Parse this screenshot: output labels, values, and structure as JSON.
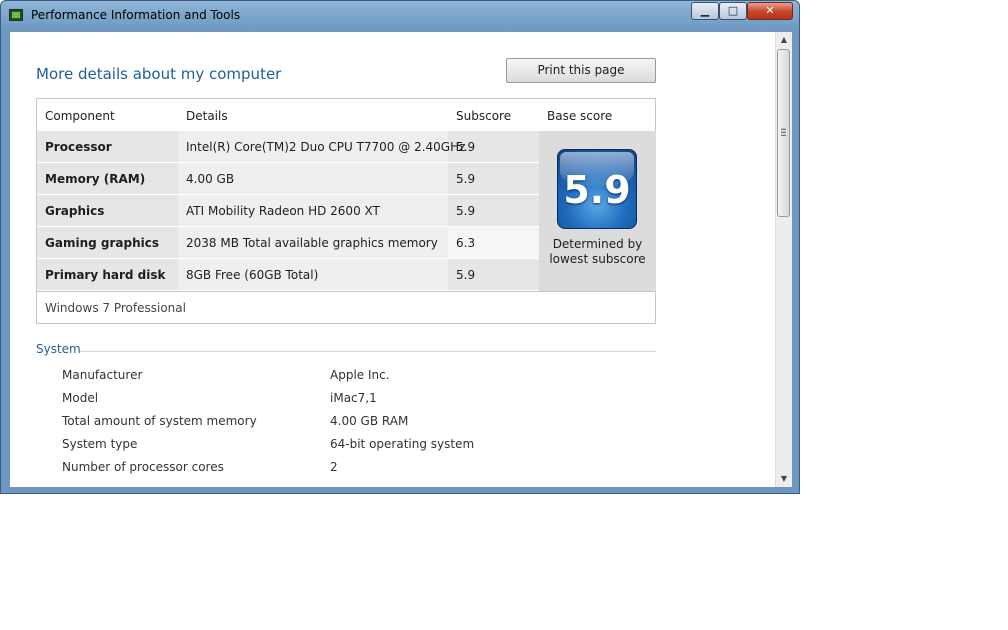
{
  "window": {
    "title": "Performance Information and Tools",
    "min_label": "▁",
    "max_label": "□",
    "close_label": "✕"
  },
  "page": {
    "heading": "More details about my computer",
    "print_label": "Print this page"
  },
  "score_table": {
    "headers": {
      "component": "Component",
      "details": "Details",
      "subscore": "Subscore",
      "base_score": "Base score"
    },
    "rows": [
      {
        "component": "Processor",
        "details": "Intel(R) Core(TM)2 Duo CPU T7700 @ 2.40GHz",
        "subscore": "5.9"
      },
      {
        "component": "Memory (RAM)",
        "details": "4.00 GB",
        "subscore": "5.9"
      },
      {
        "component": "Graphics",
        "details": "ATI Mobility Radeon HD 2600 XT",
        "subscore": "5.9"
      },
      {
        "component": "Gaming graphics",
        "details": "2038 MB Total available graphics memory",
        "subscore": "6.3"
      },
      {
        "component": "Primary hard disk",
        "details": "8GB Free (60GB Total)",
        "subscore": "5.9"
      }
    ],
    "base_score": "5.9",
    "base_note_line1": "Determined by",
    "base_note_line2": "lowest subscore",
    "os": "Windows 7 Professional"
  },
  "system": {
    "title": "System",
    "items": [
      {
        "label": "Manufacturer",
        "value": "Apple Inc."
      },
      {
        "label": "Model",
        "value": "iMac7,1"
      },
      {
        "label": "Total amount of system memory",
        "value": "4.00 GB RAM"
      },
      {
        "label": "System type",
        "value": "64-bit operating system"
      },
      {
        "label": "Number of processor cores",
        "value": "2"
      }
    ]
  },
  "scrollbar": {
    "up_icon": "scroll-up-arrow",
    "down_icon": "scroll-down-arrow"
  }
}
